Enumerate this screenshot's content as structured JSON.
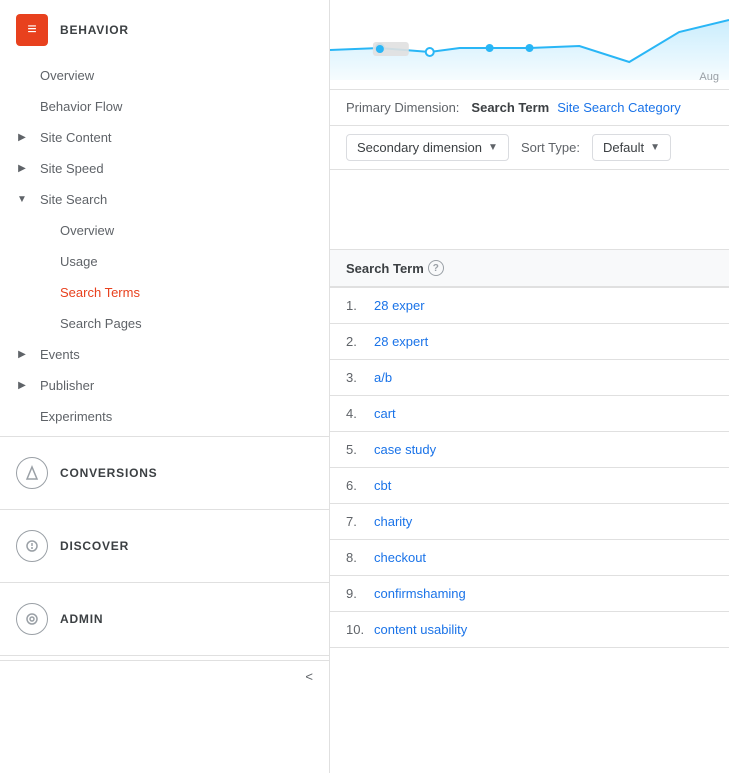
{
  "sidebar": {
    "behavior_icon": "≡",
    "behavior_title": "BEHAVIOR",
    "nav_items": [
      {
        "id": "overview",
        "label": "Overview",
        "level": "level2",
        "active": false,
        "arrow": null
      },
      {
        "id": "behavior-flow",
        "label": "Behavior Flow",
        "level": "level2",
        "active": false,
        "arrow": null
      },
      {
        "id": "site-content",
        "label": "Site Content",
        "level": "level1",
        "active": false,
        "arrow": "right"
      },
      {
        "id": "site-speed",
        "label": "Site Speed",
        "level": "level1",
        "active": false,
        "arrow": "right"
      },
      {
        "id": "site-search",
        "label": "Site Search",
        "level": "level1",
        "active": false,
        "arrow": "down"
      },
      {
        "id": "search-overview",
        "label": "Overview",
        "level": "level3",
        "active": false,
        "arrow": null
      },
      {
        "id": "usage",
        "label": "Usage",
        "level": "level3",
        "active": false,
        "arrow": null
      },
      {
        "id": "search-terms",
        "label": "Search Terms",
        "level": "level3",
        "active": true,
        "arrow": null
      },
      {
        "id": "search-pages",
        "label": "Search Pages",
        "level": "level3",
        "active": false,
        "arrow": null
      },
      {
        "id": "events",
        "label": "Events",
        "level": "level1",
        "active": false,
        "arrow": "right"
      },
      {
        "id": "publisher",
        "label": "Publisher",
        "level": "level1",
        "active": false,
        "arrow": "right"
      },
      {
        "id": "experiments",
        "label": "Experiments",
        "level": "level2",
        "active": false,
        "arrow": null
      }
    ],
    "conversions_title": "CONVERSIONS",
    "discover_title": "DISCOVER",
    "admin_title": "ADMIN",
    "collapse_label": "<"
  },
  "main": {
    "chart_label": "Aug",
    "primary_dimension_label": "Primary Dimension:",
    "primary_active": "Search Term",
    "primary_link": "Site Search Category",
    "secondary_dimension_label": "Secondary dimension",
    "sort_type_label": "Sort Type:",
    "sort_default": "Default",
    "table_header": "Search Term",
    "help_icon": "?",
    "rows": [
      {
        "num": "1.",
        "term": "28 exper"
      },
      {
        "num": "2.",
        "term": "28 expert"
      },
      {
        "num": "3.",
        "term": "a/b"
      },
      {
        "num": "4.",
        "term": "cart"
      },
      {
        "num": "5.",
        "term": "case study"
      },
      {
        "num": "6.",
        "term": "cbt"
      },
      {
        "num": "7.",
        "term": "charity"
      },
      {
        "num": "8.",
        "term": "checkout"
      },
      {
        "num": "9.",
        "term": "confirmshaming"
      },
      {
        "num": "10.",
        "term": "content usability"
      }
    ]
  }
}
